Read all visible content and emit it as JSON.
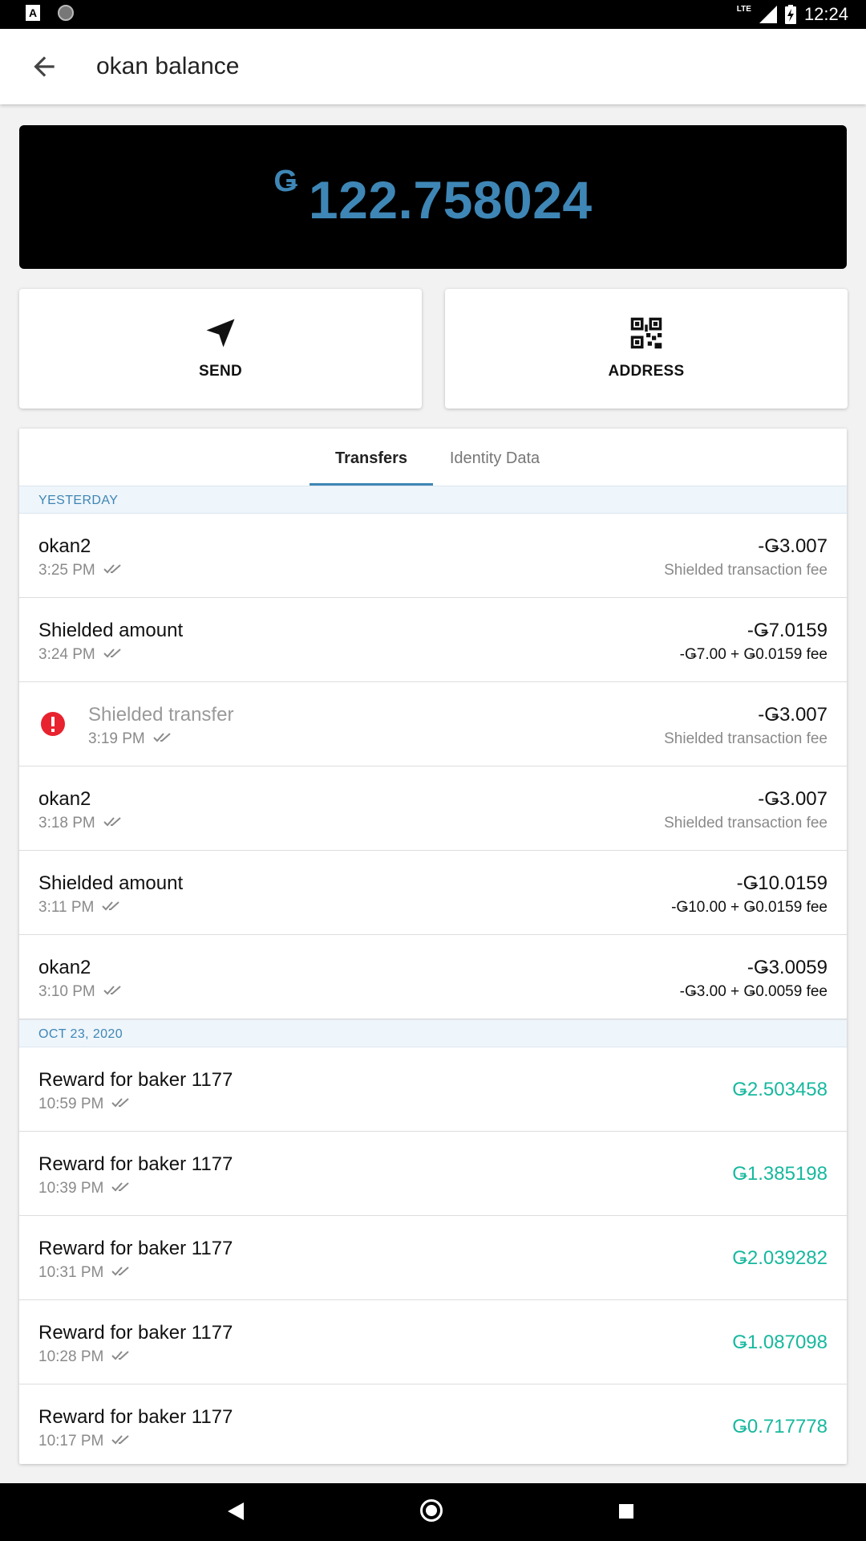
{
  "status_bar": {
    "time": "12:24",
    "network": "LTE"
  },
  "app_bar": {
    "title": "okan balance"
  },
  "balance": {
    "currency": "Ǥ",
    "value": "122.758024"
  },
  "actions": [
    {
      "label": "SEND",
      "icon": "send-icon"
    },
    {
      "label": "ADDRESS",
      "icon": "qr-code-icon"
    }
  ],
  "tabs": [
    {
      "label": "Transfers",
      "active": true
    },
    {
      "label": "Identity Data",
      "active": false
    }
  ],
  "sections": [
    {
      "header": "YESTERDAY",
      "items": [
        {
          "title": "okan2",
          "time": "3:25 PM",
          "amount": "-Ǥ3.007",
          "sub": "Shielded transaction fee",
          "failed": false
        },
        {
          "title": "Shielded amount",
          "time": "3:24 PM",
          "amount": "-Ǥ7.0159",
          "sub": "-Ǥ7.00 + Ǥ0.0159 fee",
          "failed": false
        },
        {
          "title": "Shielded transfer",
          "time": "3:19 PM",
          "amount": "-Ǥ3.007",
          "sub": "Shielded transaction fee",
          "failed": true
        },
        {
          "title": "okan2",
          "time": "3:18 PM",
          "amount": "-Ǥ3.007",
          "sub": "Shielded transaction fee",
          "failed": false
        },
        {
          "title": "Shielded amount",
          "time": "3:11 PM",
          "amount": "-Ǥ10.0159",
          "sub": "-Ǥ10.00 + Ǥ0.0159 fee",
          "failed": false
        },
        {
          "title": "okan2",
          "time": "3:10 PM",
          "amount": "-Ǥ3.0059",
          "sub": "-Ǥ3.00 + Ǥ0.0059 fee",
          "failed": false
        }
      ]
    },
    {
      "header": "OCT 23, 2020",
      "items": [
        {
          "title": "Reward for baker 1177",
          "time": "10:59 PM",
          "amount": "Ǥ2.503458"
        },
        {
          "title": "Reward for baker 1177",
          "time": "10:39 PM",
          "amount": "Ǥ1.385198"
        },
        {
          "title": "Reward for baker 1177",
          "time": "10:31 PM",
          "amount": "Ǥ2.039282"
        },
        {
          "title": "Reward for baker 1177",
          "time": "10:28 PM",
          "amount": "Ǥ1.087098"
        },
        {
          "title": "Reward for baker 1177",
          "time": "10:17 PM",
          "amount": "Ǥ0.717778"
        }
      ]
    }
  ],
  "colors": {
    "accent": "#3e86b5",
    "positive": "#17b89e",
    "error": "#e8222e"
  }
}
